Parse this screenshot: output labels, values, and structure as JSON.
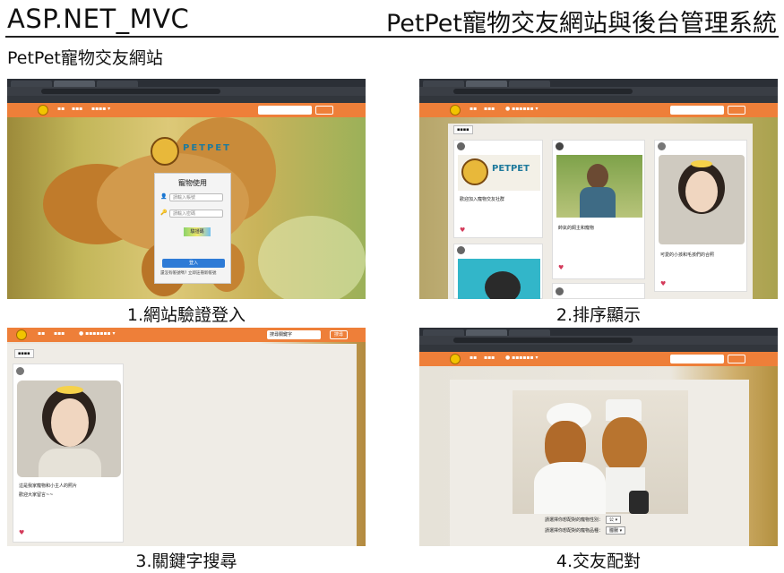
{
  "header": {
    "left_title": "ASP.NET_MVC",
    "right_title": "PetPet寵物交友網站與後台管理系統",
    "subtitle": "PetPet寵物交友網站"
  },
  "captions": {
    "c1": "1.網站驗證登入",
    "c2": "2.排序顯示",
    "c3": "3.關鍵字搜尋",
    "c4": "4.交友配對"
  },
  "panel1": {
    "login_title": "寵物使用",
    "account_placeholder": "請輸入帳號",
    "password_placeholder": "請輸入密碼",
    "captcha_text": "驗證碼",
    "login_button": "登入",
    "footer_text": "還沒有帳號嗎?  立即註冊新帳號",
    "brand": "PETPET"
  },
  "panel2": {
    "card1_title": "PETPET",
    "card1_text": "歡迎加入寵物交友社群",
    "card2_text": "帥氣的飼主和寵物",
    "card3_text": "可愛的小孩和毛孩們的合照"
  },
  "panel3": {
    "search_value": "搜尋關鍵字",
    "search_button": "搜尋",
    "card_text": "這是我家寵物和小主人的照片",
    "card_subtext": "歡迎大家留言~~"
  },
  "panel4": {
    "select1_label": "請選擇你想配對的寵物性別：",
    "select1_value": "公",
    "select2_label": "請選擇你想配對的寵物品種：",
    "select2_value": "臘腸"
  },
  "colors": {
    "nav_orange": "#ee7f39",
    "accent_blue": "#2e7bd6",
    "heart_red": "#d43a5a"
  }
}
